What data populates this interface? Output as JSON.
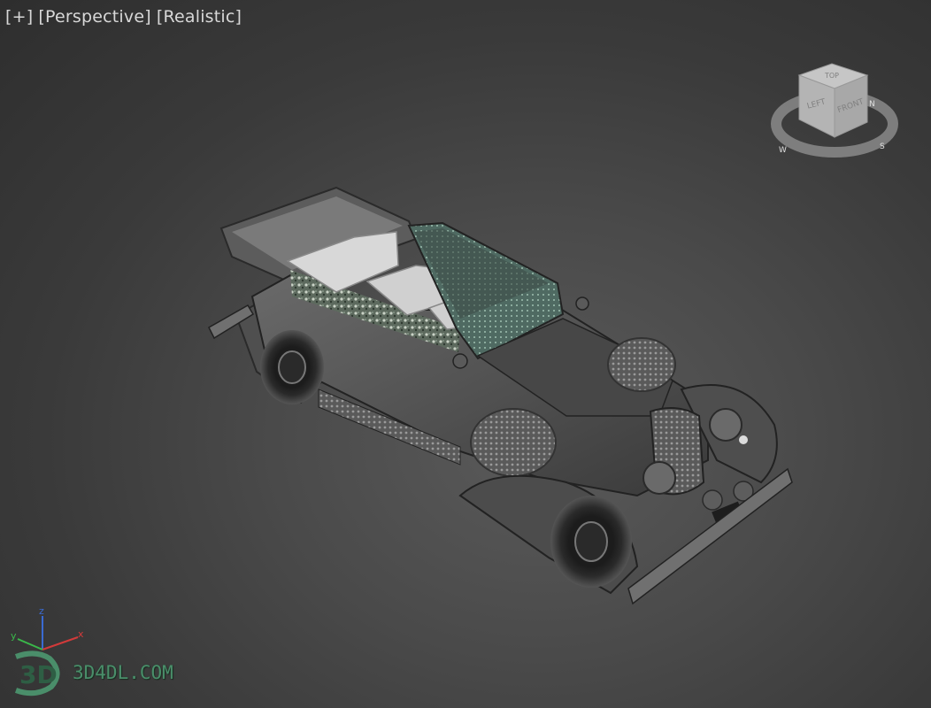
{
  "viewport": {
    "menu_plus": "[+]",
    "view_mode": "[Perspective]",
    "shading_mode": "[Realistic]"
  },
  "viewcube": {
    "face_top": "TOP",
    "face_front": "FRONT",
    "face_left": "LEFT",
    "compass": {
      "north": "N",
      "west": "W",
      "south": "S"
    }
  },
  "axis_triad": {
    "x": "x",
    "y": "y",
    "z": "z"
  },
  "watermark": {
    "logo": "3D",
    "text": "3D4DL.COM"
  },
  "colors": {
    "background": "#3c3c3c",
    "axis_x": "#d23a3a",
    "axis_y": "#3ab84a",
    "axis_z": "#3a6ad2",
    "watermark": "#4a8e6a"
  }
}
